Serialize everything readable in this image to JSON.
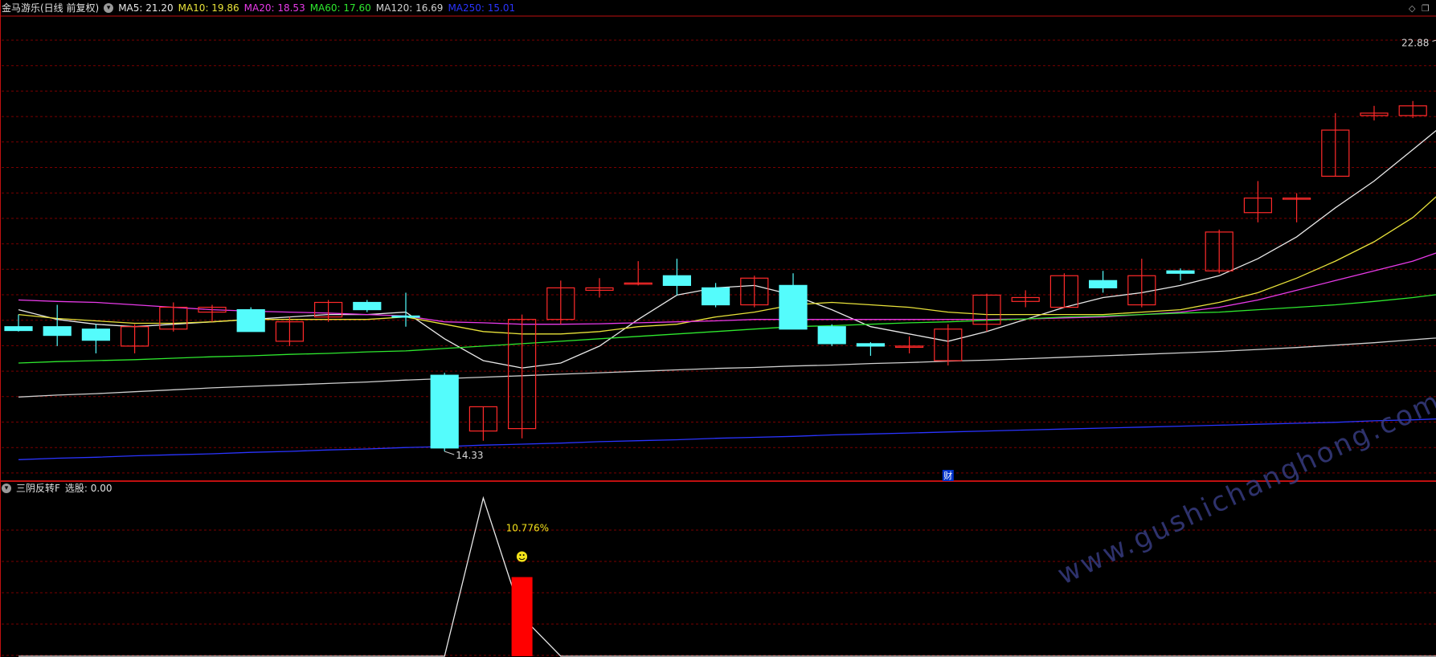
{
  "main_panel": {
    "title": "金马游乐(日线 前复权)",
    "ma_legend": [
      {
        "label": "MA5: 21.20",
        "color": "#e8e8e8"
      },
      {
        "label": "MA10: 19.86",
        "color": "#e8e23a"
      },
      {
        "label": "MA20: 18.53",
        "color": "#e83ae8"
      },
      {
        "label": "MA60: 17.60",
        "color": "#2ee82e"
      },
      {
        "label": "MA120: 16.69",
        "color": "#cfcfcf"
      },
      {
        "label": "MA250: 15.01",
        "color": "#2a34ff"
      }
    ],
    "high_label": "22.88",
    "low_label": "14.33",
    "marker_label": "财"
  },
  "sub_panel": {
    "title": "三阴反转F",
    "value_label": "选股: 0.00",
    "pct_label": "10.776%",
    "smiley": "☻"
  },
  "watermark": "www.gushichanghong.com",
  "colors": {
    "up": "#ff2a2a",
    "down": "#54fcfc",
    "grid": "#7a0000",
    "frame": "#c01010"
  },
  "chart_data": [
    {
      "type": "candlestick",
      "title": "金马游乐(日线 前复权)",
      "ylim": [
        13.9,
        23.3
      ],
      "candles": [
        {
          "o": 16.9,
          "h": 17.15,
          "l": 16.8,
          "c": 16.82
        },
        {
          "o": 16.9,
          "h": 17.35,
          "l": 16.5,
          "c": 16.72
        },
        {
          "o": 16.85,
          "h": 16.95,
          "l": 16.35,
          "c": 16.62
        },
        {
          "o": 16.5,
          "h": 16.95,
          "l": 16.35,
          "c": 16.9
        },
        {
          "o": 16.85,
          "h": 17.4,
          "l": 16.8,
          "c": 17.3
        },
        {
          "o": 17.2,
          "h": 17.35,
          "l": 17.0,
          "c": 17.3
        },
        {
          "o": 17.25,
          "h": 17.3,
          "l": 16.8,
          "c": 16.8
        },
        {
          "o": 16.6,
          "h": 17.1,
          "l": 16.5,
          "c": 17.0
        },
        {
          "o": 17.1,
          "h": 17.45,
          "l": 17.0,
          "c": 17.4
        },
        {
          "o": 17.4,
          "h": 17.45,
          "l": 17.2,
          "c": 17.25
        },
        {
          "o": 17.12,
          "h": 17.6,
          "l": 16.9,
          "c": 17.1
        },
        {
          "o": 15.9,
          "h": 15.95,
          "l": 14.33,
          "c": 14.4
        },
        {
          "o": 14.75,
          "h": 15.25,
          "l": 14.55,
          "c": 15.25
        },
        {
          "o": 14.8,
          "h": 17.15,
          "l": 14.6,
          "c": 17.05
        },
        {
          "o": 17.05,
          "h": 17.85,
          "l": 16.95,
          "c": 17.7
        },
        {
          "o": 17.65,
          "h": 17.9,
          "l": 17.5,
          "c": 17.7
        },
        {
          "o": 17.8,
          "h": 18.25,
          "l": 17.75,
          "c": 17.8
        },
        {
          "o": 17.95,
          "h": 18.3,
          "l": 17.55,
          "c": 17.75
        },
        {
          "o": 17.7,
          "h": 17.8,
          "l": 17.3,
          "c": 17.35
        },
        {
          "o": 17.35,
          "h": 17.95,
          "l": 17.3,
          "c": 17.9
        },
        {
          "o": 17.75,
          "h": 18.0,
          "l": 16.85,
          "c": 16.85
        },
        {
          "o": 16.9,
          "h": 16.95,
          "l": 16.5,
          "c": 16.55
        },
        {
          "o": 16.55,
          "h": 16.58,
          "l": 16.3,
          "c": 16.5
        },
        {
          "o": 16.5,
          "h": 16.7,
          "l": 16.35,
          "c": 16.5
        },
        {
          "o": 16.2,
          "h": 16.95,
          "l": 16.1,
          "c": 16.85
        },
        {
          "o": 16.95,
          "h": 17.58,
          "l": 16.8,
          "c": 17.55
        },
        {
          "o": 17.42,
          "h": 17.65,
          "l": 17.3,
          "c": 17.5
        },
        {
          "o": 17.3,
          "h": 18.0,
          "l": 17.3,
          "c": 17.95
        },
        {
          "o": 17.85,
          "h": 18.05,
          "l": 17.6,
          "c": 17.7
        },
        {
          "o": 17.35,
          "h": 18.3,
          "l": 17.3,
          "c": 17.95
        },
        {
          "o": 18.05,
          "h": 18.1,
          "l": 17.85,
          "c": 18.0
        },
        {
          "o": 18.05,
          "h": 18.9,
          "l": 18.0,
          "c": 18.85
        },
        {
          "o": 19.25,
          "h": 19.9,
          "l": 19.05,
          "c": 19.55
        },
        {
          "o": 19.55,
          "h": 19.65,
          "l": 19.05,
          "c": 19.55
        },
        {
          "o": 20.0,
          "h": 21.3,
          "l": 20.0,
          "c": 20.95
        },
        {
          "o": 21.25,
          "h": 21.45,
          "l": 21.15,
          "c": 21.3
        },
        {
          "o": 21.25,
          "h": 21.55,
          "l": 21.2,
          "c": 21.45
        },
        {
          "o": 21.75,
          "h": 22.88,
          "l": 21.5,
          "c": 22.6
        }
      ],
      "ma": [
        {
          "name": "MA5",
          "color": "#e8e8e8",
          "values": [
            17.25,
            17.05,
            16.95,
            16.9,
            16.95,
            17.0,
            17.05,
            17.1,
            17.15,
            17.15,
            17.2,
            16.65,
            16.2,
            16.05,
            16.15,
            16.5,
            17.05,
            17.55,
            17.7,
            17.75,
            17.55,
            17.25,
            16.9,
            16.75,
            16.6,
            16.8,
            17.05,
            17.3,
            17.5,
            17.6,
            17.75,
            17.95,
            18.3,
            18.75,
            19.35,
            19.9,
            20.55,
            21.2
          ]
        },
        {
          "name": "MA10",
          "color": "#e8e23a",
          "values": [
            17.15,
            17.07,
            17.02,
            16.97,
            16.97,
            17.0,
            17.05,
            17.05,
            17.05,
            17.05,
            17.1,
            16.95,
            16.8,
            16.75,
            16.75,
            16.8,
            16.9,
            16.95,
            17.1,
            17.2,
            17.35,
            17.4,
            17.35,
            17.3,
            17.2,
            17.15,
            17.15,
            17.15,
            17.15,
            17.2,
            17.25,
            17.4,
            17.6,
            17.9,
            18.25,
            18.65,
            19.15,
            19.86
          ]
        },
        {
          "name": "MA20",
          "color": "#e83ae8",
          "values": [
            17.45,
            17.42,
            17.4,
            17.35,
            17.3,
            17.25,
            17.22,
            17.2,
            17.18,
            17.15,
            17.12,
            17.0,
            16.98,
            16.95,
            16.95,
            16.96,
            16.98,
            17.0,
            17.02,
            17.05,
            17.05,
            17.05,
            17.05,
            17.05,
            17.05,
            17.05,
            17.06,
            17.08,
            17.1,
            17.15,
            17.2,
            17.3,
            17.45,
            17.65,
            17.85,
            18.05,
            18.25,
            18.53
          ]
        },
        {
          "name": "MA60",
          "color": "#2ee82e",
          "values": [
            16.15,
            16.18,
            16.2,
            16.22,
            16.25,
            16.28,
            16.3,
            16.33,
            16.35,
            16.38,
            16.4,
            16.45,
            16.5,
            16.55,
            16.6,
            16.65,
            16.7,
            16.75,
            16.8,
            16.85,
            16.9,
            16.92,
            16.95,
            16.98,
            17.0,
            17.03,
            17.06,
            17.1,
            17.12,
            17.15,
            17.18,
            17.2,
            17.25,
            17.3,
            17.35,
            17.42,
            17.5,
            17.6
          ]
        },
        {
          "name": "MA120",
          "color": "#cfcfcf",
          "values": [
            15.45,
            15.49,
            15.52,
            15.56,
            15.6,
            15.64,
            15.67,
            15.7,
            15.73,
            15.76,
            15.8,
            15.83,
            15.86,
            15.89,
            15.92,
            15.95,
            15.98,
            16.01,
            16.04,
            16.06,
            16.09,
            16.11,
            16.14,
            16.16,
            16.19,
            16.21,
            16.24,
            16.27,
            16.3,
            16.33,
            16.36,
            16.39,
            16.43,
            16.47,
            16.52,
            16.57,
            16.63,
            16.69
          ]
        },
        {
          "name": "MA250",
          "color": "#2a34ff",
          "values": [
            14.16,
            14.19,
            14.21,
            14.24,
            14.26,
            14.28,
            14.31,
            14.33,
            14.36,
            14.38,
            14.41,
            14.43,
            14.46,
            14.48,
            14.5,
            14.53,
            14.55,
            14.57,
            14.6,
            14.62,
            14.64,
            14.67,
            14.69,
            14.71,
            14.73,
            14.75,
            14.77,
            14.79,
            14.81,
            14.83,
            14.85,
            14.87,
            14.89,
            14.91,
            14.93,
            14.96,
            14.98,
            15.01
          ]
        }
      ]
    },
    {
      "type": "line",
      "title": "三阴反转F",
      "ylim": [
        0,
        1
      ],
      "line": [
        0,
        0,
        0,
        0,
        0,
        0,
        0,
        0,
        0,
        0,
        0,
        0,
        1,
        0.25,
        0,
        0,
        0,
        0,
        0,
        0,
        0,
        0,
        0,
        0,
        0,
        0,
        0,
        0,
        0,
        0,
        0,
        0,
        0,
        0,
        0,
        0,
        0,
        0
      ],
      "bars": [
        {
          "index": 13,
          "value": 0.5
        }
      ]
    }
  ]
}
